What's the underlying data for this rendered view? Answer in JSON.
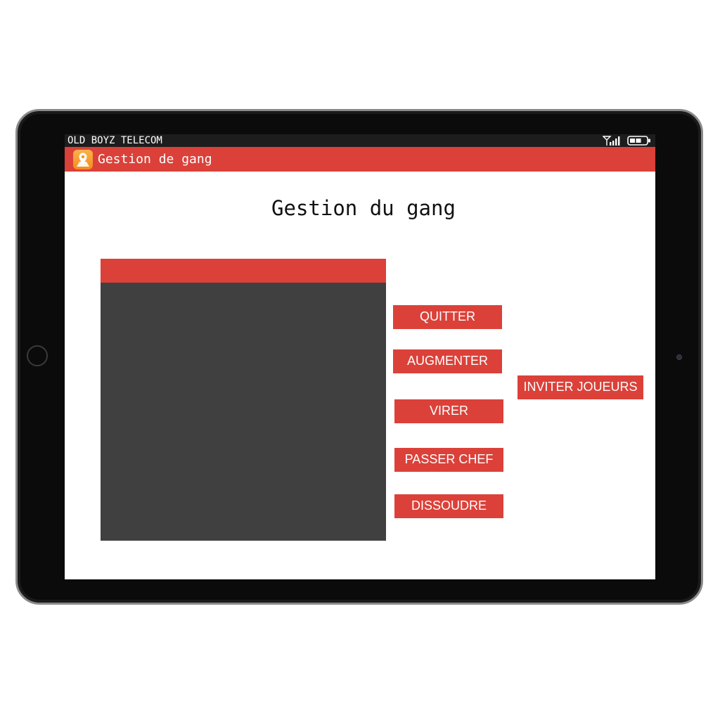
{
  "status_bar": {
    "carrier": "OLD BOYZ TELECOM",
    "signal_icon": "signal-bars-icon",
    "battery_icon": "battery-icon"
  },
  "app_bar": {
    "icon": "map-pin-icon",
    "title": "Gestion de gang",
    "color": "#db4139"
  },
  "page": {
    "title": "Gestion du gang"
  },
  "buttons": {
    "quit": "QUITTER",
    "promote": "AUGMENTER",
    "kick": "VIRER",
    "transfer_leader": "PASSER CHEF",
    "dissolve": "DISSOUDRE",
    "invite": "INVITER JOUEURS"
  },
  "colors": {
    "accent": "#db4139",
    "panel": "#404040",
    "status_bar": "#1d1d1d"
  }
}
